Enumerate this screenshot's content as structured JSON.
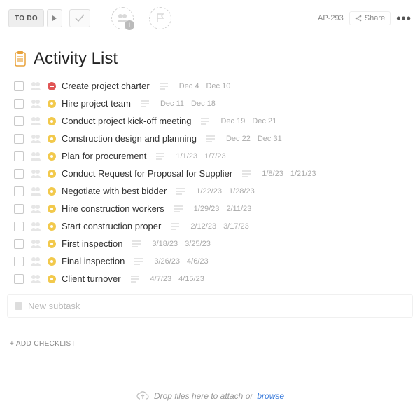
{
  "header": {
    "todo_label": "TO DO",
    "ticket": "AP-293",
    "share_label": "Share"
  },
  "page": {
    "title": "Activity List"
  },
  "tasks": [
    {
      "name": "Create project charter",
      "status": "red",
      "start": "Dec 4",
      "end": "Dec 10"
    },
    {
      "name": "Hire project team",
      "status": "yellow",
      "start": "Dec 11",
      "end": "Dec 18"
    },
    {
      "name": "Conduct project kick-off meeting",
      "status": "yellow",
      "start": "Dec 19",
      "end": "Dec 21"
    },
    {
      "name": "Construction design and planning",
      "status": "yellow",
      "start": "Dec 22",
      "end": "Dec 31"
    },
    {
      "name": "Plan for procurement",
      "status": "yellow",
      "start": "1/1/23",
      "end": "1/7/23"
    },
    {
      "name": "Conduct Request for Proposal for Supplier",
      "status": "yellow",
      "start": "1/8/23",
      "end": "1/21/23"
    },
    {
      "name": "Negotiate with best bidder",
      "status": "yellow",
      "start": "1/22/23",
      "end": "1/28/23"
    },
    {
      "name": "Hire construction workers",
      "status": "yellow",
      "start": "1/29/23",
      "end": "2/11/23"
    },
    {
      "name": "Start construction proper",
      "status": "yellow",
      "start": "2/12/23",
      "end": "3/17/23"
    },
    {
      "name": "First inspection",
      "status": "yellow",
      "start": "3/18/23",
      "end": "3/25/23"
    },
    {
      "name": "Final inspection",
      "status": "yellow",
      "start": "3/26/23",
      "end": "4/6/23"
    },
    {
      "name": "Client turnover",
      "status": "yellow",
      "start": "4/7/23",
      "end": "4/15/23"
    }
  ],
  "newsub_placeholder": "New subtask",
  "add_checklist_label": "+ ADD CHECKLIST",
  "dropzone": {
    "text": "Drop files here to attach or ",
    "link": "browse"
  }
}
